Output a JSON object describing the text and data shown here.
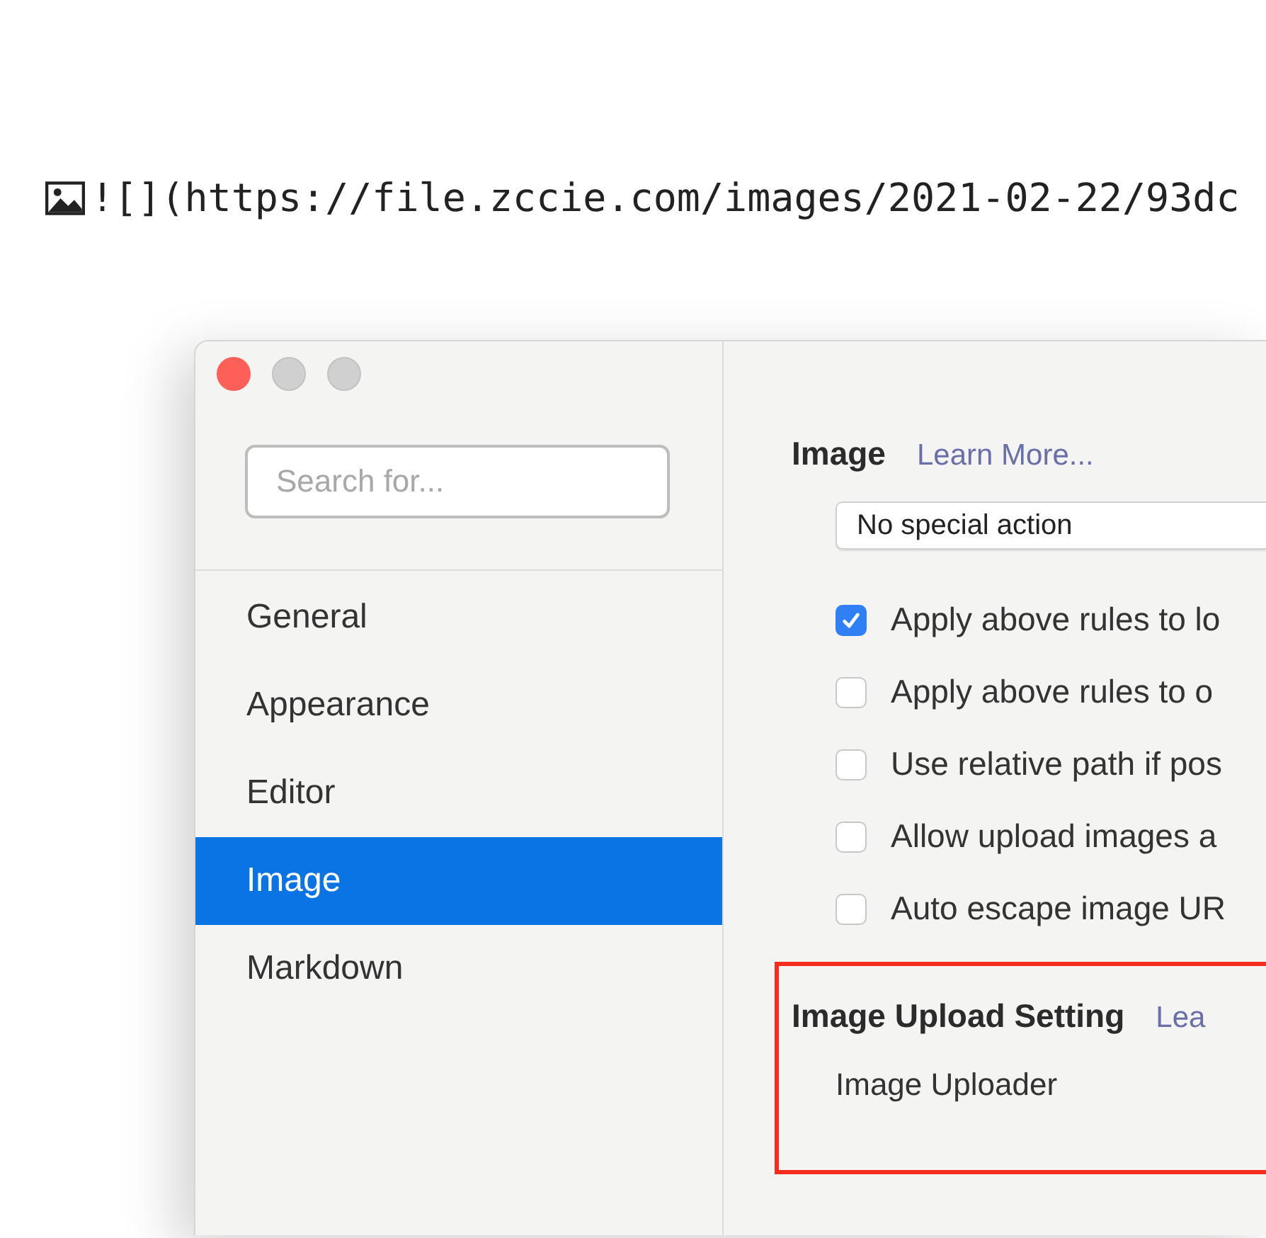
{
  "markdown_line": {
    "text": "![](https://file.zccie.com/images/2021-02-22/93dc"
  },
  "sidebar": {
    "search": {
      "placeholder": "Search for..."
    },
    "items": [
      {
        "label": "General",
        "selected": false
      },
      {
        "label": "Appearance",
        "selected": false
      },
      {
        "label": "Editor",
        "selected": false
      },
      {
        "label": "Image",
        "selected": true
      },
      {
        "label": "Markdown",
        "selected": false
      }
    ]
  },
  "image_section": {
    "title": "Image",
    "link": "Learn More...",
    "dropdown": {
      "value": "No special action"
    },
    "options": [
      {
        "label": "Apply above rules to lo",
        "checked": true
      },
      {
        "label": "Apply above rules to o",
        "checked": false
      },
      {
        "label": "Use relative path if pos",
        "checked": false
      },
      {
        "label": "Allow upload images a",
        "checked": false
      },
      {
        "label": "Auto escape image UR",
        "checked": false
      }
    ]
  },
  "upload_section": {
    "title": "Image Upload Setting",
    "link": "Lea",
    "highlighted": true,
    "field_label": "Image Uploader"
  }
}
